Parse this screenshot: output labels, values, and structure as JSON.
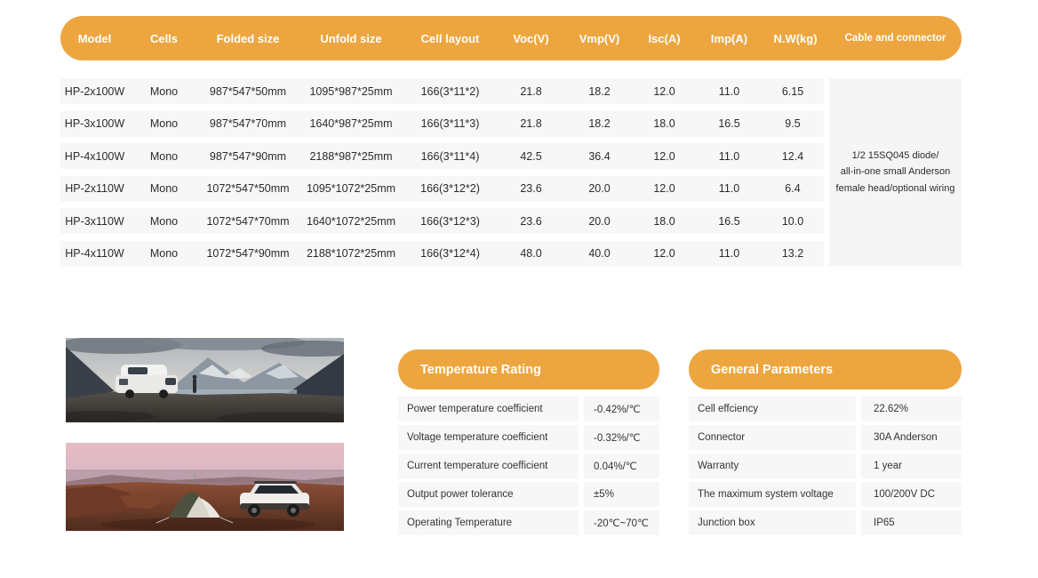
{
  "theme": {
    "accent_orange": "#EDA63F",
    "row_gray": "#F7F7F7",
    "cable_cell_gray": "#F5F5F5",
    "text_dark": "#2B2B2B"
  },
  "spec_table": {
    "columns": [
      "Model",
      "Cells",
      "Folded size",
      "Unfold size",
      "Cell layout",
      "Voc(V)",
      "Vmp(V)",
      "Isc(A)",
      "Imp(A)",
      "N.W(kg)",
      "Cable and connector"
    ],
    "rows": [
      [
        "HP-2x100W",
        "Mono",
        "987*547*50mm",
        "1095*987*25mm",
        "166(3*11*2)",
        "21.8",
        "18.2",
        "12.0",
        "11.0",
        "6.15"
      ],
      [
        "HP-3x100W",
        "Mono",
        "987*547*70mm",
        "1640*987*25mm",
        "166(3*11*3)",
        "21.8",
        "18.2",
        "18.0",
        "16.5",
        "9.5"
      ],
      [
        "HP-4x100W",
        "Mono",
        "987*547*90mm",
        "2188*987*25mm",
        "166(3*11*4)",
        "42.5",
        "36.4",
        "12.0",
        "11.0",
        "12.4"
      ],
      [
        "HP-2x110W",
        "Mono",
        "1072*547*50mm",
        "1095*1072*25mm",
        "166(3*12*2)",
        "23.6",
        "20.0",
        "12.0",
        "11.0",
        "6.4"
      ],
      [
        "HP-3x110W",
        "Mono",
        "1072*547*70mm",
        "1640*1072*25mm",
        "166(3*12*3)",
        "23.6",
        "20.0",
        "18.0",
        "16.5",
        "10.0"
      ],
      [
        "HP-4x110W",
        "Mono",
        "1072*547*90mm",
        "2188*1072*25mm",
        "166(3*12*4)",
        "48.0",
        "40.0",
        "12.0",
        "11.0",
        "13.2"
      ]
    ],
    "cable_note": {
      "line1": "1/2  15SQ045 diode/",
      "line2": "all-in-one small Anderson",
      "line3": "female head/optional wiring"
    }
  },
  "temperature_rating": {
    "title": "Temperature Rating",
    "rows": [
      {
        "label": "Power temperature coefficient",
        "value": "-0.42%/℃"
      },
      {
        "label": "Voltage temperature coefficient",
        "value": "-0.32%/℃"
      },
      {
        "label": "Current temperature coefficient",
        "value": "0.04%/℃"
      },
      {
        "label": "Output power tolerance",
        "value": "±5%"
      },
      {
        "label": "Operating Temperature",
        "value": "-20℃~70℃"
      }
    ]
  },
  "general_parameters": {
    "title": "General Parameters",
    "rows": [
      {
        "label": "Cell effciency",
        "value": "22.62%"
      },
      {
        "label": "Connector",
        "value": "30A Anderson"
      },
      {
        "label": "Warranty",
        "value": "1 year"
      },
      {
        "label": "The maximum system voltage",
        "value": "100/200V DC"
      },
      {
        "label": "Junction box",
        "value": "IP65"
      }
    ]
  },
  "photos": [
    {
      "name": "campervan-mountain-twilight"
    },
    {
      "name": "tent-suv-desert-dusk"
    }
  ]
}
